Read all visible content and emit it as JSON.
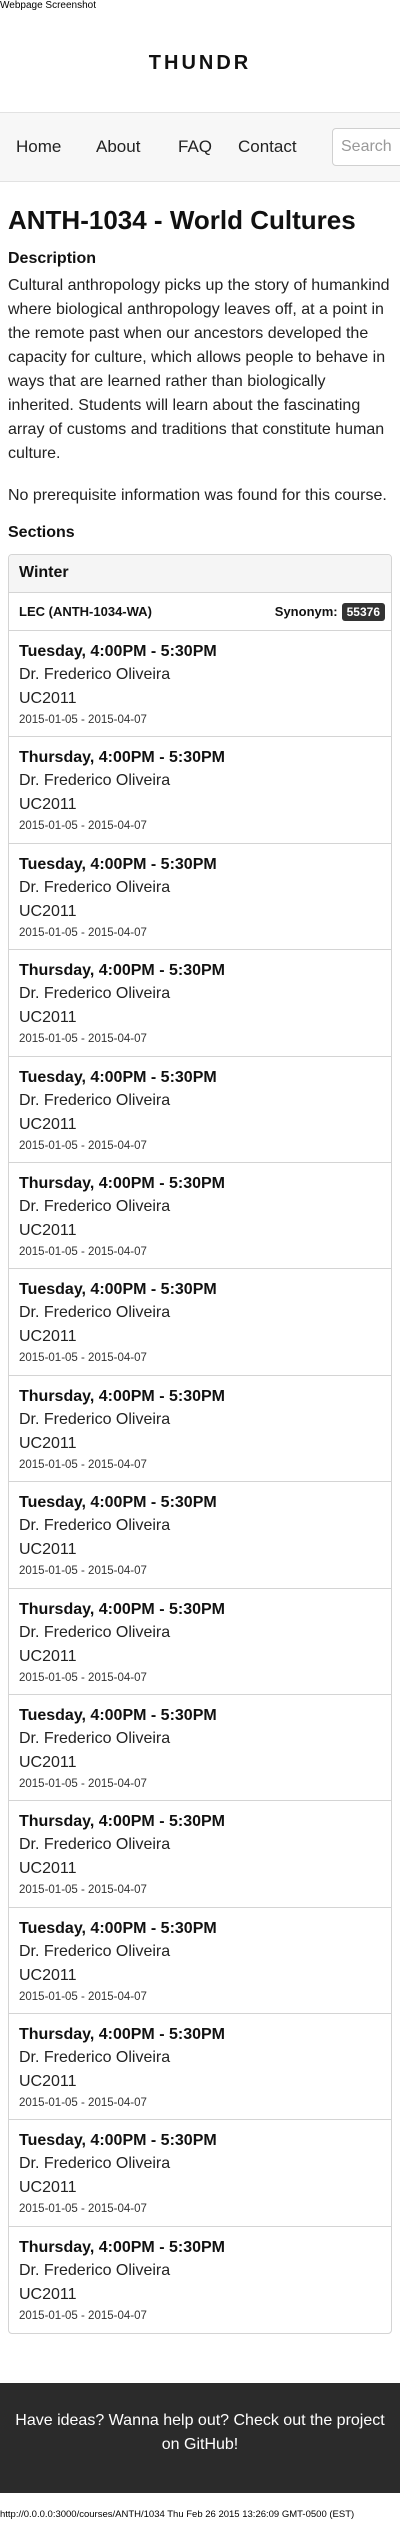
{
  "screenshot_label": "Webpage Screenshot",
  "header": {
    "logo": "THUNDR"
  },
  "nav": {
    "items": [
      {
        "label": "Home"
      },
      {
        "label": "About"
      },
      {
        "label": "FAQ"
      },
      {
        "label": "Contact"
      }
    ],
    "search_placeholder": "Search"
  },
  "course": {
    "title": "ANTH-1034 - World Cultures",
    "description_heading": "Description",
    "description": "Cultural anthropology picks up the story of humankind where biological anthropology leaves off, at a point in the remote past when our ancestors developed the capacity for culture, which allows people to behave in ways that are learned rather than biologically inherited. Students will learn about the fascinating array of customs and traditions that constitute human culture.",
    "prerequisite": "No prerequisite information was found for this course.",
    "sections_heading": "Sections"
  },
  "term": {
    "name": "Winter",
    "section_type": "LEC (ANTH-1034-WA)",
    "synonym_label": "Synonym:",
    "synonym_value": "55376",
    "meetings": [
      {
        "time": "Tuesday, 4:00PM - 5:30PM",
        "professor": "Dr. Frederico Oliveira",
        "room": "UC2011",
        "dates": "2015-01-05 - 2015-04-07"
      },
      {
        "time": "Thursday, 4:00PM - 5:30PM",
        "professor": "Dr. Frederico Oliveira",
        "room": "UC2011",
        "dates": "2015-01-05 - 2015-04-07"
      },
      {
        "time": "Tuesday, 4:00PM - 5:30PM",
        "professor": "Dr. Frederico Oliveira",
        "room": "UC2011",
        "dates": "2015-01-05 - 2015-04-07"
      },
      {
        "time": "Thursday, 4:00PM - 5:30PM",
        "professor": "Dr. Frederico Oliveira",
        "room": "UC2011",
        "dates": "2015-01-05 - 2015-04-07"
      },
      {
        "time": "Tuesday, 4:00PM - 5:30PM",
        "professor": "Dr. Frederico Oliveira",
        "room": "UC2011",
        "dates": "2015-01-05 - 2015-04-07"
      },
      {
        "time": "Thursday, 4:00PM - 5:30PM",
        "professor": "Dr. Frederico Oliveira",
        "room": "UC2011",
        "dates": "2015-01-05 - 2015-04-07"
      },
      {
        "time": "Tuesday, 4:00PM - 5:30PM",
        "professor": "Dr. Frederico Oliveira",
        "room": "UC2011",
        "dates": "2015-01-05 - 2015-04-07"
      },
      {
        "time": "Thursday, 4:00PM - 5:30PM",
        "professor": "Dr. Frederico Oliveira",
        "room": "UC2011",
        "dates": "2015-01-05 - 2015-04-07"
      },
      {
        "time": "Tuesday, 4:00PM - 5:30PM",
        "professor": "Dr. Frederico Oliveira",
        "room": "UC2011",
        "dates": "2015-01-05 - 2015-04-07"
      },
      {
        "time": "Thursday, 4:00PM - 5:30PM",
        "professor": "Dr. Frederico Oliveira",
        "room": "UC2011",
        "dates": "2015-01-05 - 2015-04-07"
      },
      {
        "time": "Tuesday, 4:00PM - 5:30PM",
        "professor": "Dr. Frederico Oliveira",
        "room": "UC2011",
        "dates": "2015-01-05 - 2015-04-07"
      },
      {
        "time": "Thursday, 4:00PM - 5:30PM",
        "professor": "Dr. Frederico Oliveira",
        "room": "UC2011",
        "dates": "2015-01-05 - 2015-04-07"
      },
      {
        "time": "Tuesday, 4:00PM - 5:30PM",
        "professor": "Dr. Frederico Oliveira",
        "room": "UC2011",
        "dates": "2015-01-05 - 2015-04-07"
      },
      {
        "time": "Thursday, 4:00PM - 5:30PM",
        "professor": "Dr. Frederico Oliveira",
        "room": "UC2011",
        "dates": "2015-01-05 - 2015-04-07"
      },
      {
        "time": "Tuesday, 4:00PM - 5:30PM",
        "professor": "Dr. Frederico Oliveira",
        "room": "UC2011",
        "dates": "2015-01-05 - 2015-04-07"
      },
      {
        "time": "Thursday, 4:00PM - 5:30PM",
        "professor": "Dr. Frederico Oliveira",
        "room": "UC2011",
        "dates": "2015-01-05 - 2015-04-07"
      }
    ]
  },
  "footer": {
    "text": "Have ideas? Wanna help out? Check out the project on GitHub!"
  },
  "status_url": "http://0.0.0.0:3000/courses/ANTH/1034 Thu Feb 26 2015 13:26:09 GMT-0500 (EST)"
}
